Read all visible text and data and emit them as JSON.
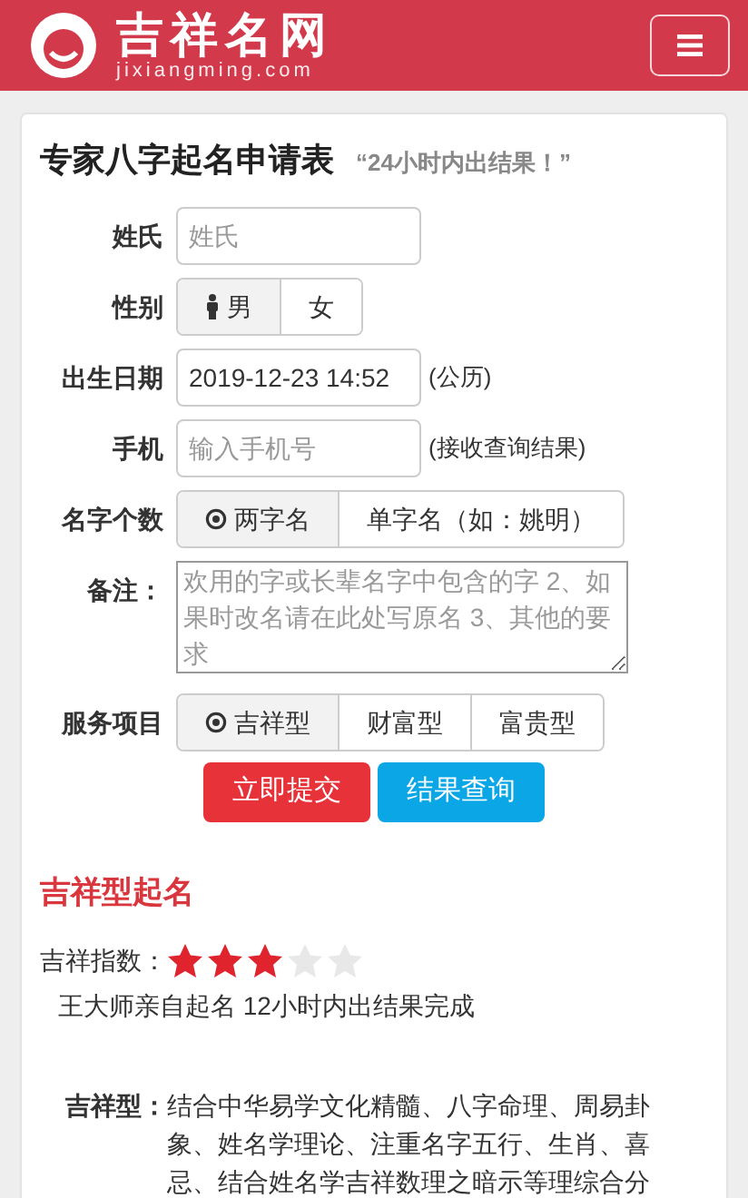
{
  "header": {
    "logo_text": "吉祥名网",
    "logo_domain": "jixiangming.com"
  },
  "form": {
    "title": "专家八字起名申请表",
    "subtitle": "“24小时内出结果！”",
    "surname": {
      "label": "姓氏",
      "placeholder": "姓氏"
    },
    "gender": {
      "label": "性别",
      "options": [
        {
          "label": "男",
          "selected": true
        },
        {
          "label": "女",
          "selected": false
        }
      ]
    },
    "birth": {
      "label": "出生日期",
      "value": "2019-12-23 14:52",
      "note": "(公历)"
    },
    "phone": {
      "label": "手机",
      "placeholder": "输入手机号",
      "note": "(接收查询结果)"
    },
    "name_length": {
      "label": "名字个数",
      "options": [
        {
          "label": "两字名",
          "selected": true
        },
        {
          "label": "单字名（如：姚明）",
          "selected": false
        }
      ]
    },
    "remarks": {
      "label": "备注：",
      "placeholder": "欢用的字或长辈名字中包含的字 2、如果时改名请在此处写原名 3、其他的要求"
    },
    "service": {
      "label": "服务项目",
      "options": [
        {
          "label": "吉祥型",
          "selected": true
        },
        {
          "label": "财富型",
          "selected": false
        },
        {
          "label": "富贵型",
          "selected": false
        }
      ]
    },
    "buttons": [
      {
        "label": "立即提交",
        "kind": "primary"
      },
      {
        "label": "结果查询",
        "kind": "info"
      }
    ]
  },
  "result": {
    "title": "吉祥型起名",
    "index_label": "吉祥指数：",
    "stars": 3,
    "summary": "王大师亲自起名 12小时内出结果完成",
    "detail_label": "吉祥型：",
    "detail": "结合中华易学文化精髓、八字命理、周易卦象、姓名学理论、注重名字五行、生肖、喜忌、结合姓名学吉祥数理之暗示等理综合分"
  }
}
